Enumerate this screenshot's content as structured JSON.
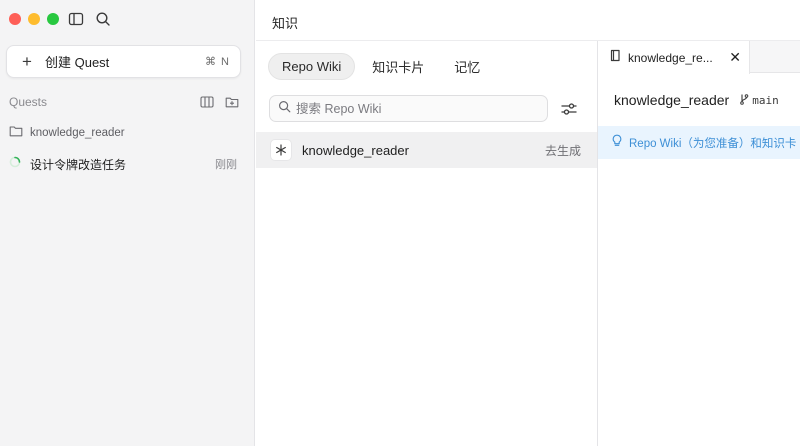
{
  "sidebar": {
    "new_quest": {
      "label": "创建 Quest",
      "shortcut": "⌘ N"
    },
    "section_title": "Quests",
    "folder": {
      "label": "knowledge_reader"
    },
    "task": {
      "label": "设计令牌改造任务",
      "time": "刚刚"
    }
  },
  "header": {
    "title": "知识"
  },
  "knowledge": {
    "tabs": [
      {
        "label": "Repo Wiki",
        "active": true
      },
      {
        "label": "知识卡片",
        "active": false
      },
      {
        "label": "记忆",
        "active": false
      }
    ],
    "search_placeholder": "搜索 Repo Wiki",
    "repo": {
      "name": "knowledge_reader",
      "action": "去生成"
    }
  },
  "editor": {
    "tab_label": "knowledge_re...",
    "repo_title": "knowledge_reader",
    "branch": "main",
    "banner_text": "Repo Wiki（为您准备）和知识卡"
  },
  "colors": {
    "traffic_red": "#fe5f57",
    "traffic_yellow": "#febc2e",
    "traffic_green": "#28c840",
    "banner_bg": "#e9f4fe",
    "banner_text": "#3d8fd6",
    "selected_row": "#f0f0f1"
  }
}
